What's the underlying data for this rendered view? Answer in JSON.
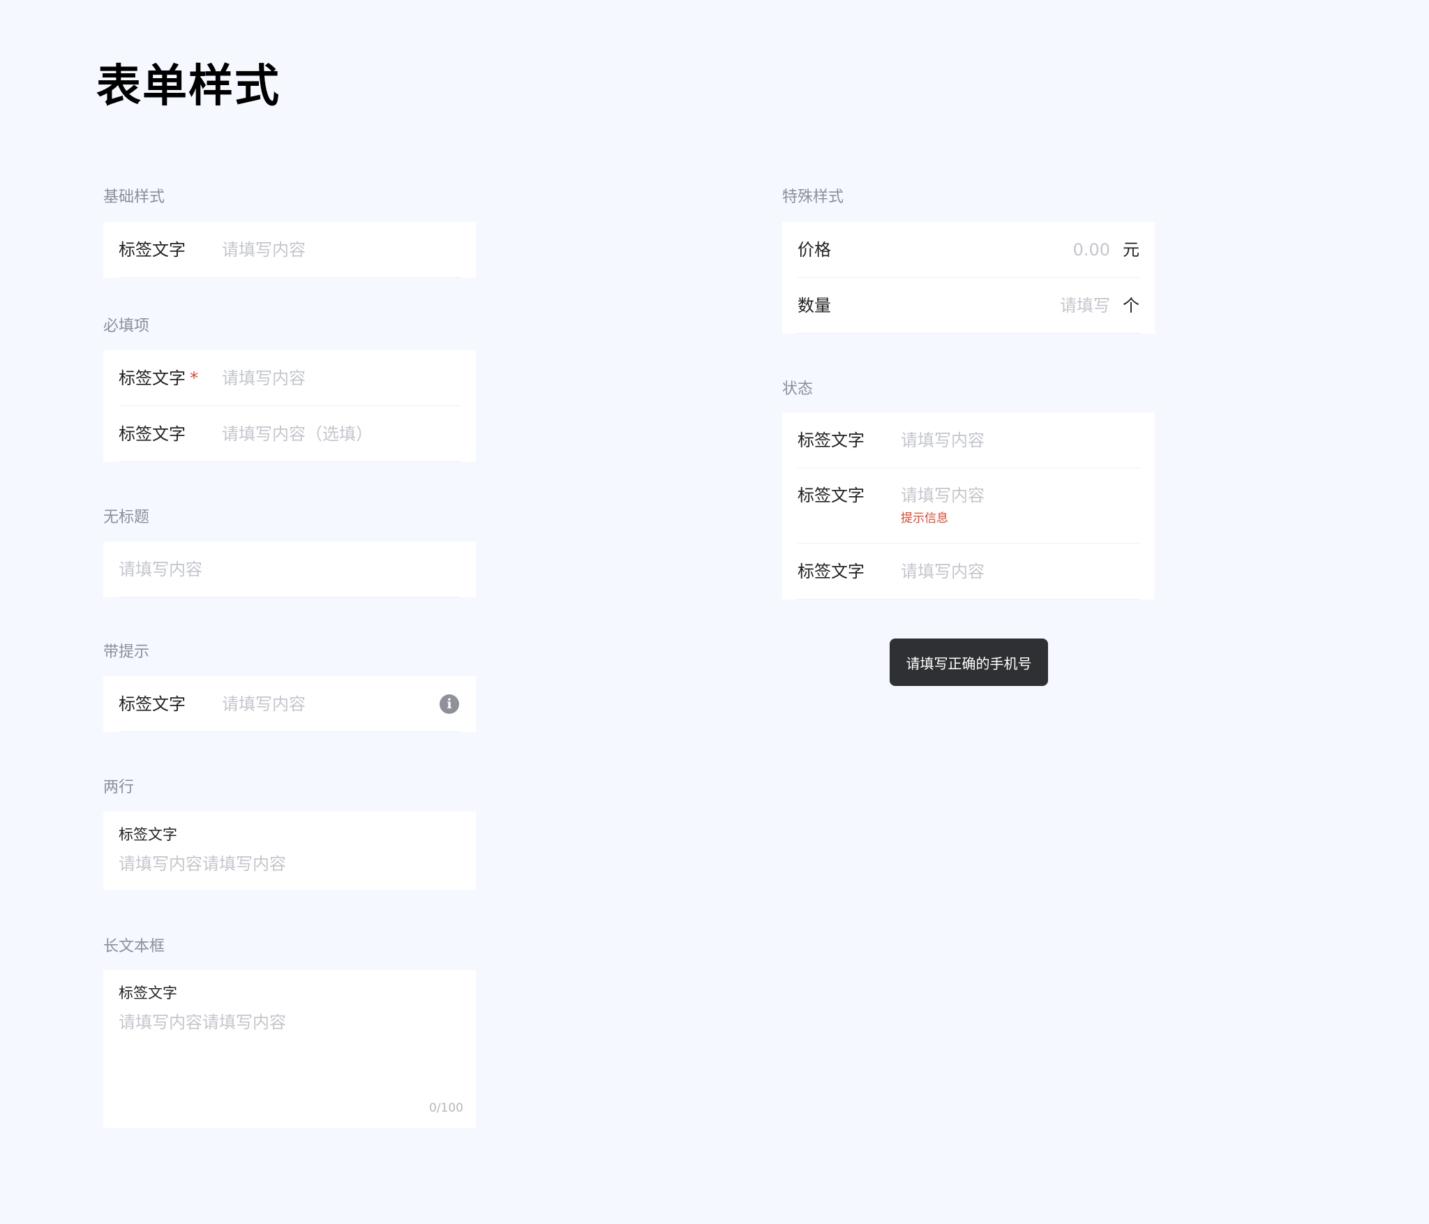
{
  "page": {
    "title": "表单样式"
  },
  "basic": {
    "section_title": "基础样式",
    "label": "标签文字",
    "placeholder": "请填写内容"
  },
  "required": {
    "section_title": "必填项",
    "row1_label": "标签文字",
    "row1_required_mark": "*",
    "row1_placeholder": "请填写内容",
    "row2_label": "标签文字",
    "row2_placeholder": "请填写内容（选填）"
  },
  "no_title": {
    "section_title": "无标题",
    "placeholder": "请填写内容"
  },
  "with_tip": {
    "section_title": "带提示",
    "label": "标签文字",
    "placeholder": "请填写内容",
    "info_icon": "info-icon",
    "info_glyph": "i"
  },
  "two_line": {
    "section_title": "两行",
    "label": "标签文字",
    "placeholder": "请填写内容请填写内容"
  },
  "long_text": {
    "section_title": "长文本框",
    "label": "标签文字",
    "placeholder": "请填写内容请填写内容",
    "counter": "0/100"
  },
  "special": {
    "section_title": "特殊样式",
    "price_label": "价格",
    "price_placeholder": "0.00",
    "price_unit": "元",
    "qty_label": "数量",
    "qty_placeholder": "请填写",
    "qty_unit": "个"
  },
  "status": {
    "section_title": "状态",
    "row1_label": "标签文字",
    "row1_placeholder": "请填写内容",
    "row2_label": "标签文字",
    "row2_placeholder": "请填写内容",
    "row2_error": "提示信息",
    "row3_label": "标签文字",
    "row3_placeholder": "请填写内容"
  },
  "toast": {
    "message": "请填写正确的手机号"
  },
  "colors": {
    "background": "#f5f8fe",
    "card": "#ffffff",
    "error": "#e0462f",
    "placeholder": "#c3c6cc",
    "toast_bg": "#2e3033"
  }
}
